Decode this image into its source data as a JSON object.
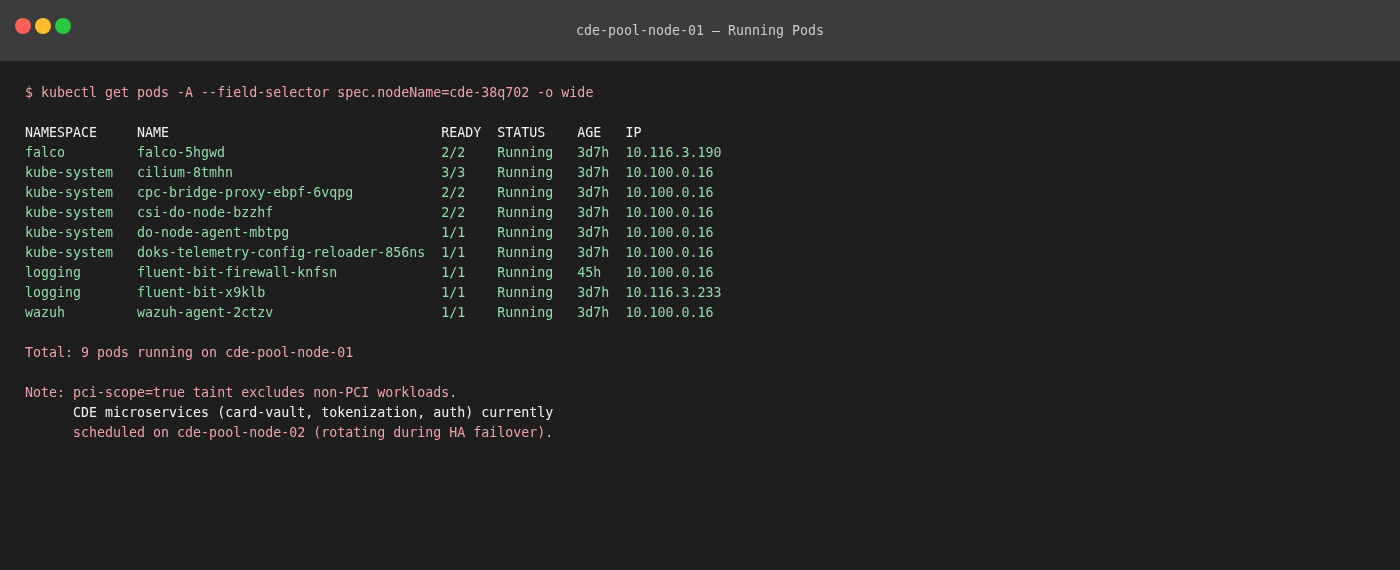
{
  "window": {
    "title": "cde-pool-node-01 — Running Pods"
  },
  "command": "$ kubectl get pods -A --field-selector spec.nodeName=cde-38q702 -o wide",
  "table": {
    "columns": [
      "NAMESPACE",
      "NAME",
      "READY",
      "STATUS",
      "AGE",
      "IP"
    ],
    "rows": [
      [
        "falco",
        "falco-5hgwd",
        "2/2",
        "Running",
        "3d7h",
        "10.116.3.190"
      ],
      [
        "kube-system",
        "cilium-8tmhn",
        "3/3",
        "Running",
        "3d7h",
        "10.100.0.16"
      ],
      [
        "kube-system",
        "cpc-bridge-proxy-ebpf-6vqpg",
        "2/2",
        "Running",
        "3d7h",
        "10.100.0.16"
      ],
      [
        "kube-system",
        "csi-do-node-bzzhf",
        "2/2",
        "Running",
        "3d7h",
        "10.100.0.16"
      ],
      [
        "kube-system",
        "do-node-agent-mbtpg",
        "1/1",
        "Running",
        "3d7h",
        "10.100.0.16"
      ],
      [
        "kube-system",
        "doks-telemetry-config-reloader-856ns",
        "1/1",
        "Running",
        "3d7h",
        "10.100.0.16"
      ],
      [
        "logging",
        "fluent-bit-firewall-knfsn",
        "1/1",
        "Running",
        "45h",
        "10.100.0.16"
      ],
      [
        "logging",
        "fluent-bit-x9klb",
        "1/1",
        "Running",
        "3d7h",
        "10.116.3.233"
      ],
      [
        "wazuh",
        "wazuh-agent-2ctzv",
        "1/1",
        "Running",
        "3d7h",
        "10.100.0.16"
      ]
    ]
  },
  "total": "Total: 9 pods running on cde-pool-node-01",
  "note": {
    "label": "Note:",
    "lines": [
      [
        {
          "text": "pci-scope=true taint excludes non-PCI workloads.",
          "color": "#f0a0a8"
        }
      ],
      [
        {
          "text": "CDE microservices (card-vault, tokenization, auth) currently",
          "color": "#f2f2f2"
        }
      ],
      [
        {
          "text": "scheduled on cde-pool-node-02 (rotating during HA failover).",
          "color": "#f0a0a8"
        }
      ]
    ]
  }
}
